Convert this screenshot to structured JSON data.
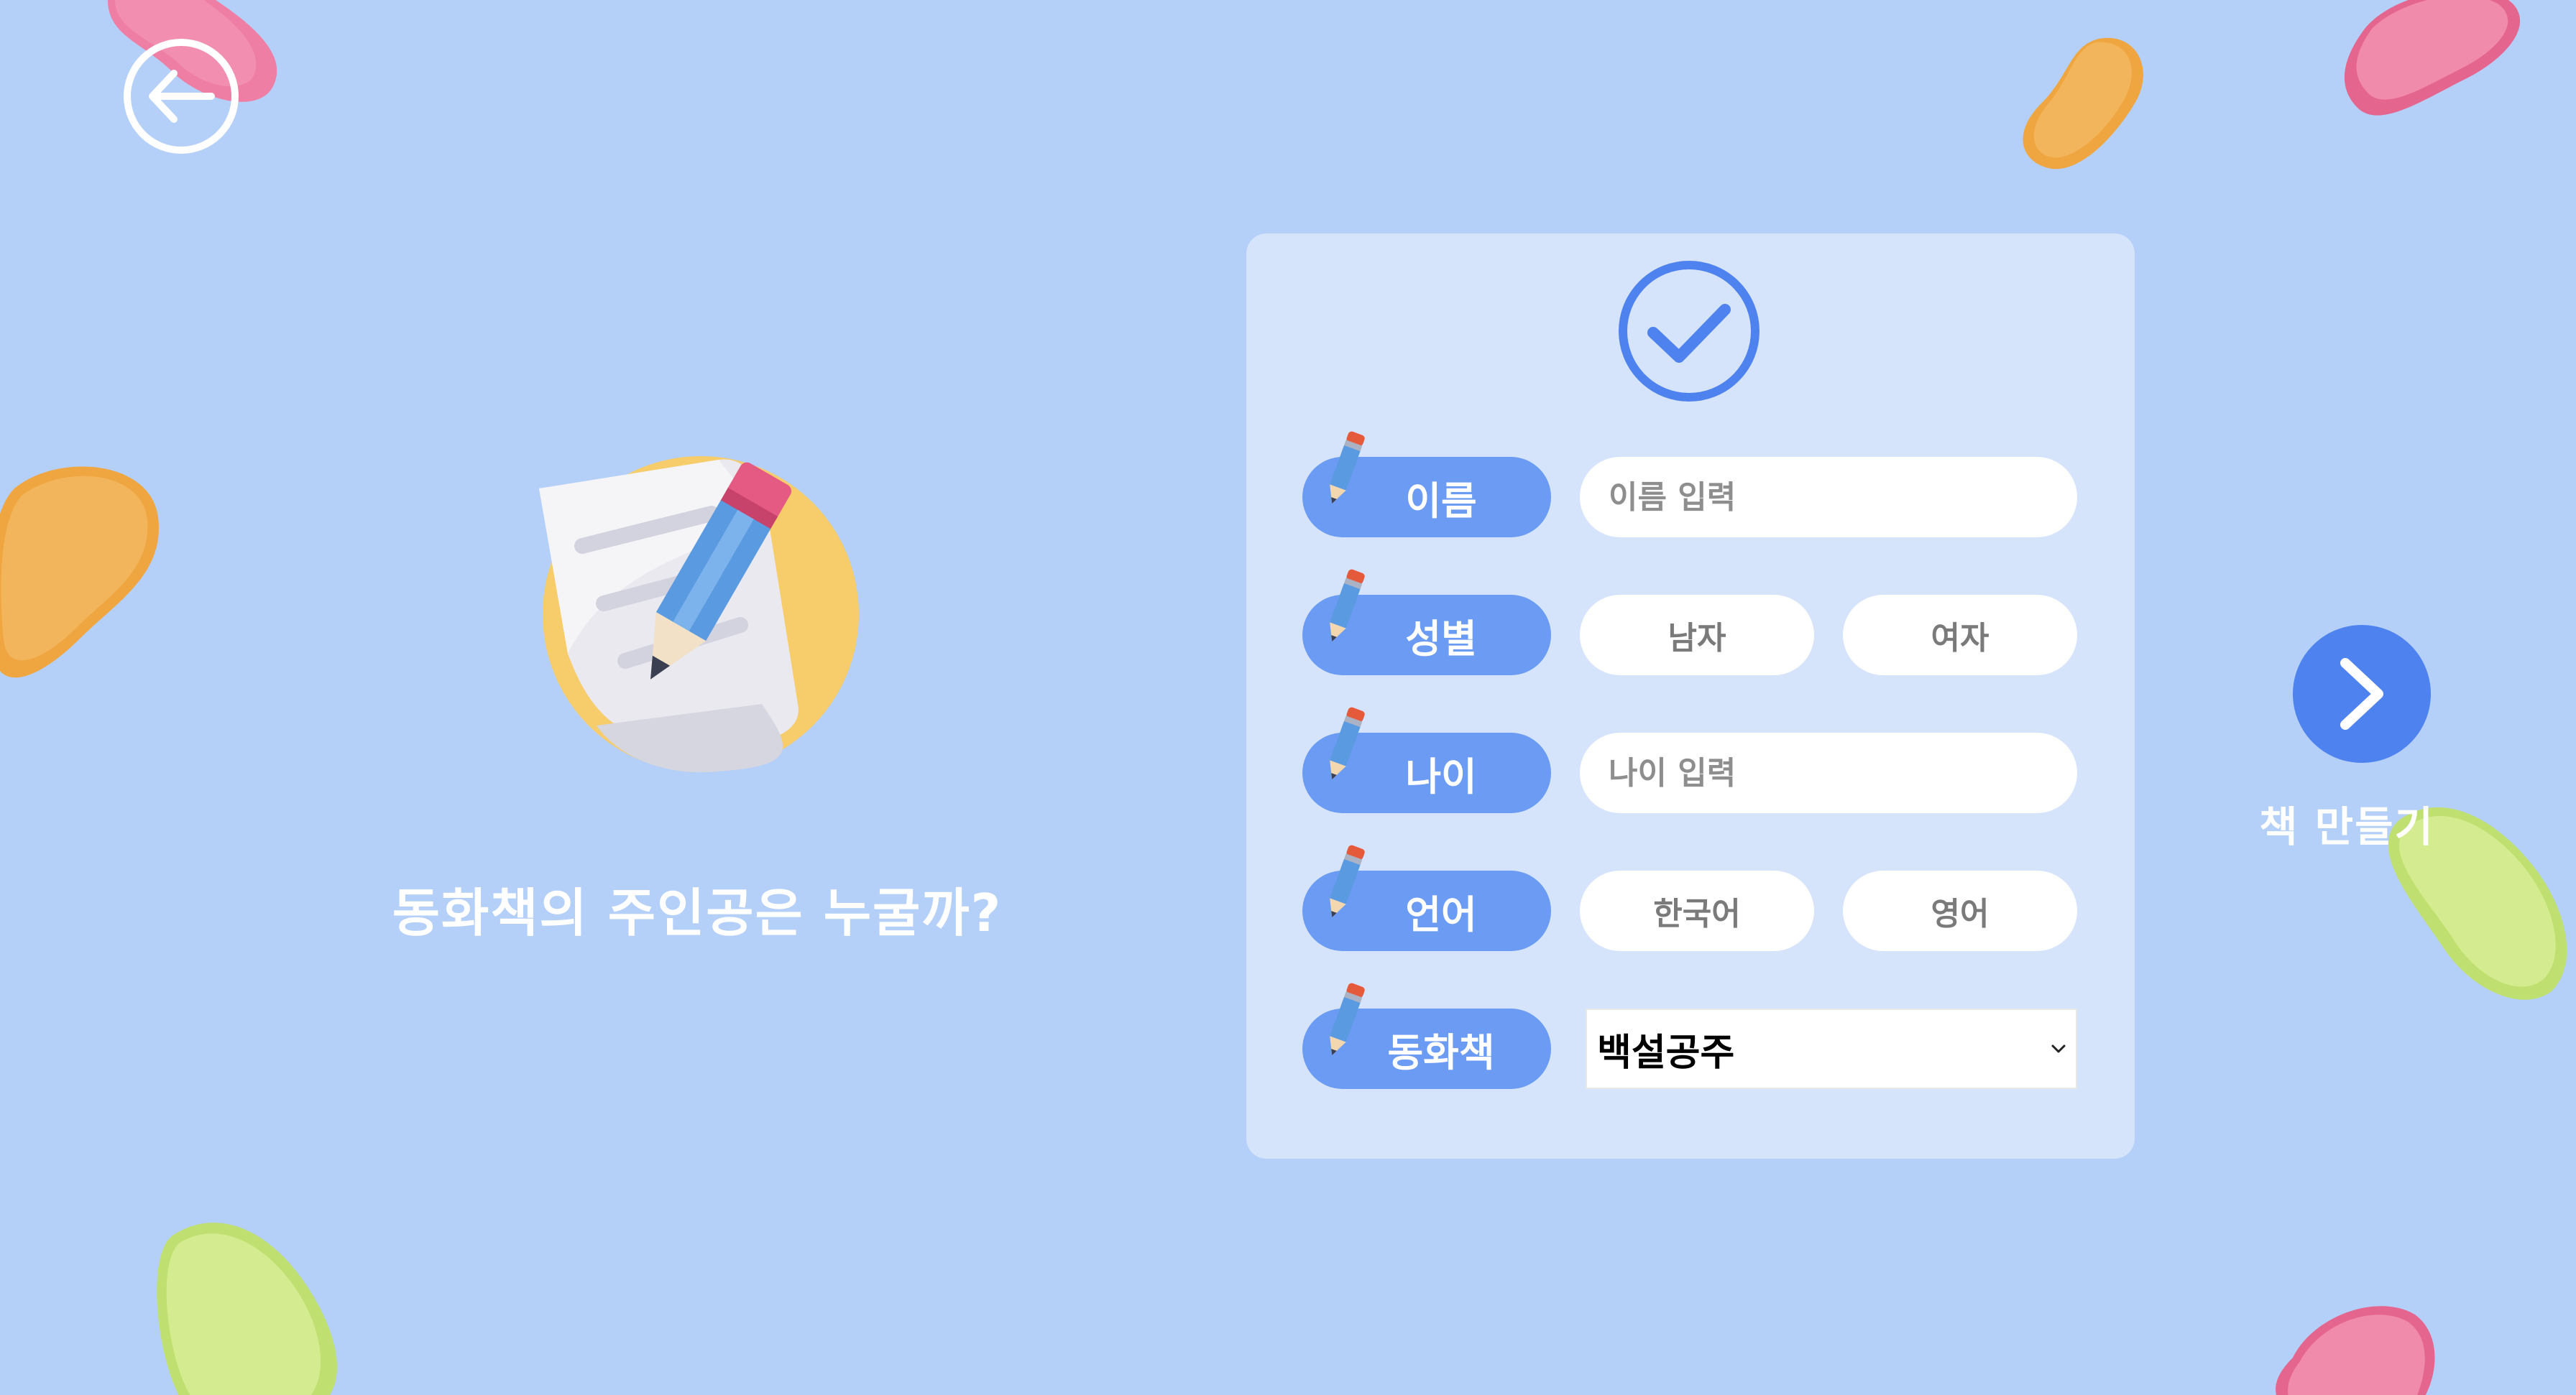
{
  "question": "동화책의 주인공은 누굴까?",
  "form": {
    "name": {
      "label": "이름",
      "placeholder": "이름 입력"
    },
    "gender": {
      "label": "성별",
      "options": [
        "남자",
        "여자"
      ]
    },
    "age": {
      "label": "나이",
      "placeholder": "나이 입력"
    },
    "language": {
      "label": "언어",
      "options": [
        "한국어",
        "영어"
      ]
    },
    "story": {
      "label": "동화책",
      "selected": "백설공주"
    }
  },
  "next": {
    "label": "책 만들기"
  },
  "colors": {
    "background": "#b5d0f8",
    "card": "#d6e4fb",
    "accent": "#4e82ee",
    "label_pill": "#6b9bf2"
  },
  "icons": {
    "back": "back-arrow-icon",
    "check": "check-circle-icon",
    "next": "chevron-right-icon",
    "pencil": "pencil-icon",
    "hero": "notepad-pencil-icon"
  }
}
